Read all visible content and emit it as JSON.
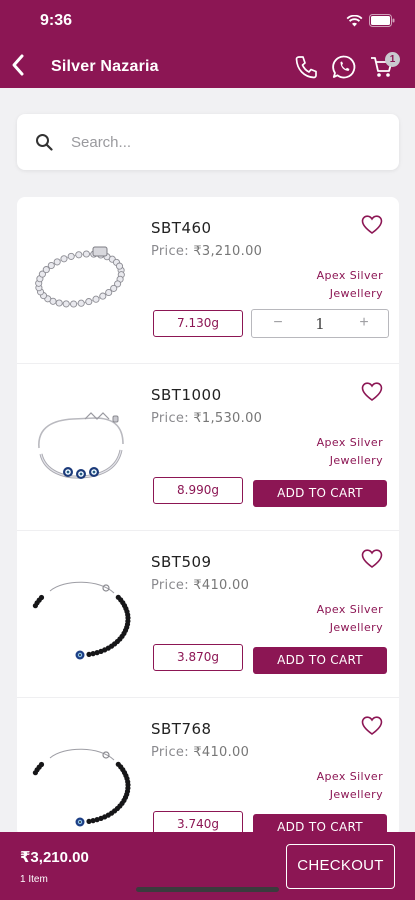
{
  "status_bar": {
    "time": "9:36"
  },
  "header": {
    "title": "Silver Nazaria",
    "cart_badge": "1"
  },
  "search": {
    "placeholder": "Search..."
  },
  "products": [
    {
      "sku": "SBT460",
      "price_label": "Price:",
      "price": "₹3,210.00",
      "maker_line1": "Apex Silver",
      "maker_line2": "Jewellery",
      "weight": "7.130g",
      "in_cart": true,
      "quantity": "1",
      "minus": "−",
      "plus": "+",
      "image": "tennis-bracelet-image"
    },
    {
      "sku": "SBT1000",
      "price_label": "Price:",
      "price": "₹1,530.00",
      "maker_line1": "Apex Silver",
      "maker_line2": "Jewellery",
      "weight": "8.990g",
      "in_cart": false,
      "add_label": "ADD TO CART",
      "image": "evil-eye-bracelet-image"
    },
    {
      "sku": "SBT509",
      "price_label": "Price:",
      "price": "₹410.00",
      "maker_line1": "Apex Silver",
      "maker_line2": "Jewellery",
      "weight": "3.870g",
      "in_cart": false,
      "add_label": "ADD TO CART",
      "image": "black-bead-bracelet-image"
    },
    {
      "sku": "SBT768",
      "price_label": "Price:",
      "price": "₹410.00",
      "maker_line1": "Apex Silver",
      "maker_line2": "Jewellery",
      "weight": "3.740g",
      "in_cart": false,
      "add_label": "ADD TO CART",
      "image": "black-bead-bracelet-image"
    }
  ],
  "footer": {
    "total": "₹3,210.00",
    "items": "1 Item",
    "checkout_label": "CHECKOUT"
  },
  "colors": {
    "brand": "#8c1654",
    "background": "#f1f1f3"
  }
}
